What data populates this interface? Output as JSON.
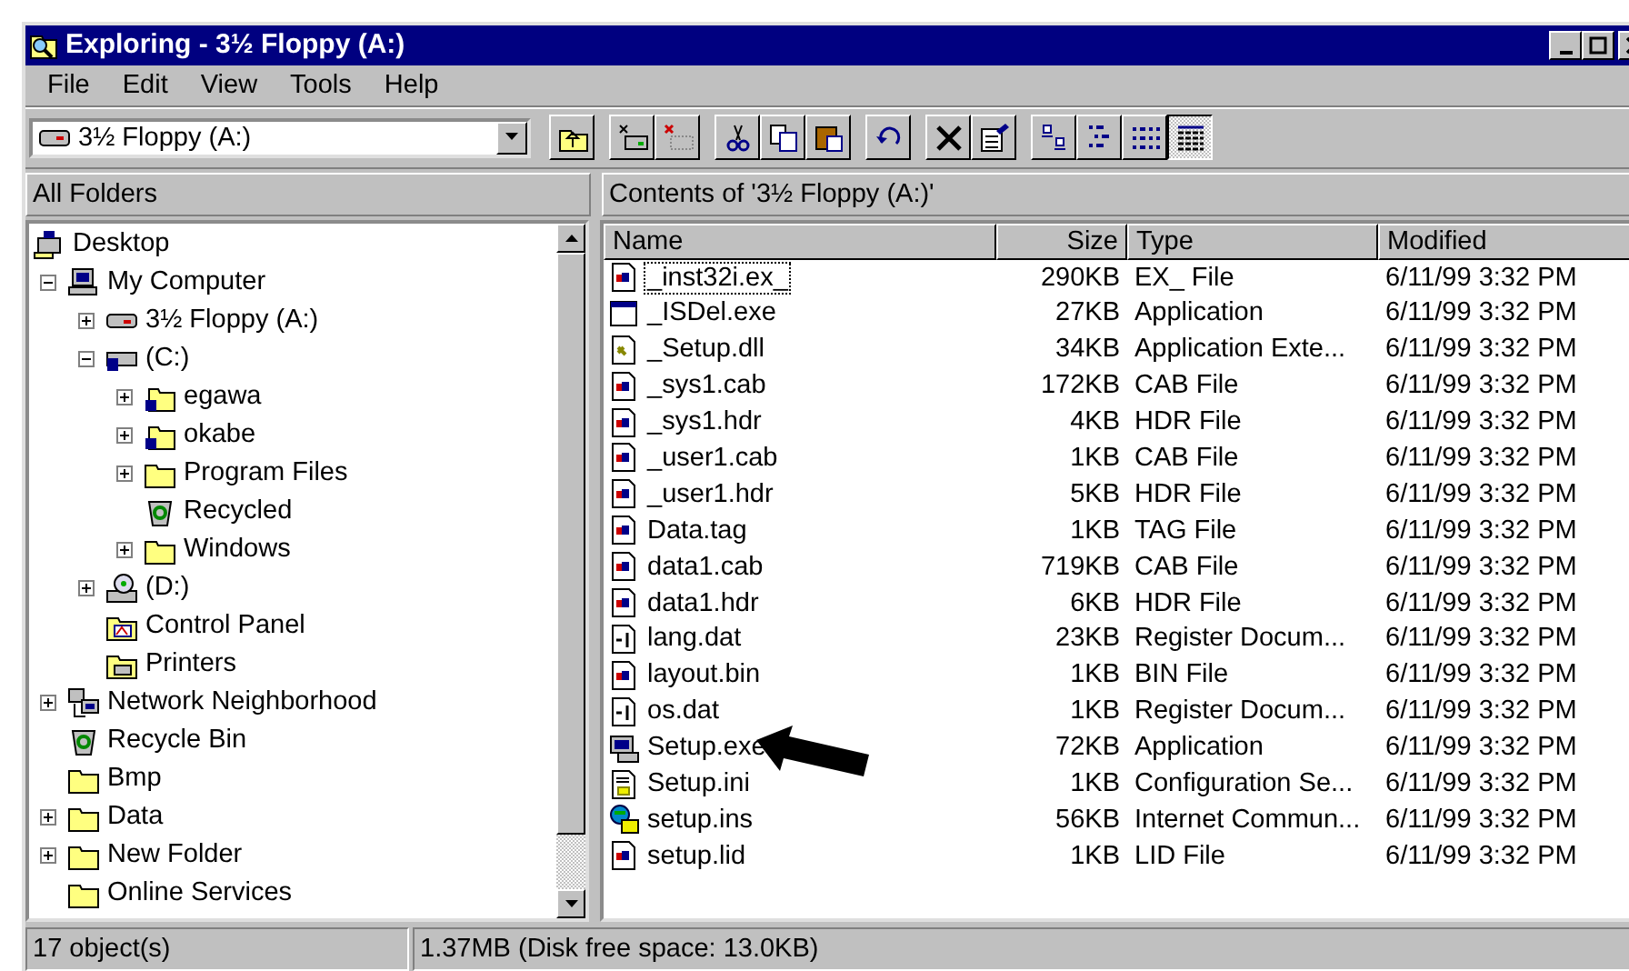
{
  "window": {
    "title": "Exploring - 3½ Floppy (A:)"
  },
  "menu": [
    "File",
    "Edit",
    "View",
    "Tools",
    "Help"
  ],
  "address": {
    "value": "3½ Floppy (A:)"
  },
  "toolbar": [
    {
      "kind": "up",
      "selected": false
    },
    {
      "kind": "map",
      "selected": false
    },
    {
      "kind": "disconnect",
      "selected": false
    },
    {
      "kind": "cut",
      "selected": false
    },
    {
      "kind": "copy",
      "selected": false
    },
    {
      "kind": "paste",
      "selected": false
    },
    {
      "kind": "undo",
      "selected": false
    },
    {
      "kind": "delete",
      "selected": false
    },
    {
      "kind": "properties",
      "selected": false
    },
    {
      "kind": "large",
      "selected": false
    },
    {
      "kind": "small",
      "selected": false
    },
    {
      "kind": "list",
      "selected": false
    },
    {
      "kind": "details",
      "selected": true
    }
  ],
  "left_header": "All Folders",
  "right_header": "Contents of '3½ Floppy (A:)'",
  "tree": [
    {
      "label": "Desktop",
      "kind": "desktop",
      "expandable": false,
      "children": [
        {
          "label": "My Computer",
          "kind": "computer",
          "expandable": true,
          "expanded": true,
          "children": [
            {
              "label": "3½ Floppy (A:)",
              "kind": "floppy",
              "expandable": true,
              "expanded": false
            },
            {
              "label": "(C:)",
              "kind": "drive",
              "expandable": true,
              "expanded": true,
              "children": [
                {
                  "label": "egawa",
                  "kind": "shared",
                  "expandable": true,
                  "expanded": false
                },
                {
                  "label": "okabe",
                  "kind": "shared",
                  "expandable": true,
                  "expanded": false
                },
                {
                  "label": "Program Files",
                  "kind": "folder",
                  "expandable": true,
                  "expanded": false
                },
                {
                  "label": "Recycled",
                  "kind": "recycle",
                  "expandable": false
                },
                {
                  "label": "Windows",
                  "kind": "folder",
                  "expandable": true,
                  "expanded": false
                }
              ]
            },
            {
              "label": "(D:)",
              "kind": "cdrom",
              "expandable": true,
              "expanded": false
            },
            {
              "label": "Control Panel",
              "kind": "control",
              "expandable": false
            },
            {
              "label": "Printers",
              "kind": "printers",
              "expandable": false
            }
          ]
        },
        {
          "label": "Network Neighborhood",
          "kind": "network",
          "expandable": true,
          "expanded": false
        },
        {
          "label": "Recycle Bin",
          "kind": "recycle",
          "expandable": false
        },
        {
          "label": "Bmp",
          "kind": "folder",
          "expandable": false
        },
        {
          "label": "Data",
          "kind": "folder",
          "expandable": true,
          "expanded": false
        },
        {
          "label": "New Folder",
          "kind": "folder",
          "expandable": true,
          "expanded": false
        },
        {
          "label": "Online Services",
          "kind": "folder",
          "expandable": false
        }
      ]
    }
  ],
  "columns": [
    "Name",
    "Size",
    "Type",
    "Modified"
  ],
  "rows": [
    {
      "name": "_inst32i.ex_",
      "size": "290KB",
      "type": "EX_ File",
      "modified": "6/11/99 3:32 PM",
      "kind": "doc",
      "focused": true,
      "pointed": false
    },
    {
      "name": "_ISDel.exe",
      "size": "27KB",
      "type": "Application",
      "modified": "6/11/99 3:32 PM",
      "kind": "window",
      "focused": false,
      "pointed": false
    },
    {
      "name": "_Setup.dll",
      "size": "34KB",
      "type": "Application Exte...",
      "modified": "6/11/99 3:32 PM",
      "kind": "dll",
      "focused": false,
      "pointed": false
    },
    {
      "name": "_sys1.cab",
      "size": "172KB",
      "type": "CAB File",
      "modified": "6/11/99 3:32 PM",
      "kind": "doc",
      "focused": false,
      "pointed": false
    },
    {
      "name": "_sys1.hdr",
      "size": "4KB",
      "type": "HDR File",
      "modified": "6/11/99 3:32 PM",
      "kind": "doc",
      "focused": false,
      "pointed": false
    },
    {
      "name": "_user1.cab",
      "size": "1KB",
      "type": "CAB File",
      "modified": "6/11/99 3:32 PM",
      "kind": "doc",
      "focused": false,
      "pointed": false
    },
    {
      "name": "_user1.hdr",
      "size": "5KB",
      "type": "HDR File",
      "modified": "6/11/99 3:32 PM",
      "kind": "doc",
      "focused": false,
      "pointed": false
    },
    {
      "name": "Data.tag",
      "size": "1KB",
      "type": "TAG File",
      "modified": "6/11/99 3:32 PM",
      "kind": "doc",
      "focused": false,
      "pointed": false
    },
    {
      "name": "data1.cab",
      "size": "719KB",
      "type": "CAB File",
      "modified": "6/11/99 3:32 PM",
      "kind": "doc",
      "focused": false,
      "pointed": false
    },
    {
      "name": "data1.hdr",
      "size": "6KB",
      "type": "HDR File",
      "modified": "6/11/99 3:32 PM",
      "kind": "doc",
      "focused": false,
      "pointed": false
    },
    {
      "name": "lang.dat",
      "size": "23KB",
      "type": "Register Docum...",
      "modified": "6/11/99 3:32 PM",
      "kind": "register",
      "focused": false,
      "pointed": false
    },
    {
      "name": "layout.bin",
      "size": "1KB",
      "type": "BIN File",
      "modified": "6/11/99 3:32 PM",
      "kind": "doc",
      "focused": false,
      "pointed": false
    },
    {
      "name": "os.dat",
      "size": "1KB",
      "type": "Register Docum...",
      "modified": "6/11/99 3:32 PM",
      "kind": "register",
      "focused": false,
      "pointed": false
    },
    {
      "name": "Setup.exe",
      "size": "72KB",
      "type": "Application",
      "modified": "6/11/99 3:32 PM",
      "kind": "setup",
      "focused": false,
      "pointed": true
    },
    {
      "name": "Setup.ini",
      "size": "1KB",
      "type": "Configuration Se...",
      "modified": "6/11/99 3:32 PM",
      "kind": "ini",
      "focused": false,
      "pointed": false
    },
    {
      "name": "setup.ins",
      "size": "56KB",
      "type": "Internet Commun...",
      "modified": "6/11/99 3:32 PM",
      "kind": "ins",
      "focused": false,
      "pointed": false
    },
    {
      "name": "setup.lid",
      "size": "1KB",
      "type": "LID File",
      "modified": "6/11/99 3:32 PM",
      "kind": "doc",
      "focused": false,
      "pointed": false
    }
  ],
  "status_bar": [
    "17 object(s)",
    "1.37MB (Disk free space: 13.0KB)"
  ]
}
